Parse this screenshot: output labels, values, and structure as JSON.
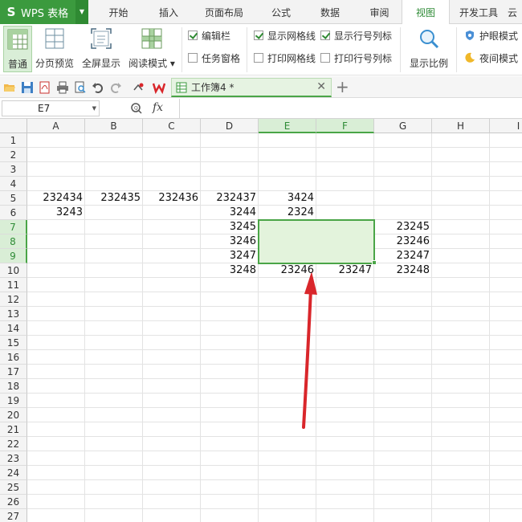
{
  "app": {
    "title": "WPS 表格"
  },
  "menu": {
    "tabs": [
      {
        "label": "开始"
      },
      {
        "label": "插入"
      },
      {
        "label": "页面布局"
      },
      {
        "label": "公式"
      },
      {
        "label": "数据"
      },
      {
        "label": "审阅"
      },
      {
        "label": "视图"
      },
      {
        "label": "开发工具"
      },
      {
        "label": "云"
      }
    ],
    "active": "视图"
  },
  "ribbon": {
    "normal": "普通",
    "page_break_preview": "分页预览",
    "full_screen": "全屏显示",
    "reading_mode": "阅读模式",
    "edit_bar": "编辑栏",
    "task_pane": "任务窗格",
    "show_gridlines": "显示网格线",
    "show_headings": "显示行号列标",
    "print_gridlines": "打印网格线",
    "print_headings": "打印行号列标",
    "zoom": "显示比例",
    "eye_care": "护眼模式",
    "night_mode": "夜间模式"
  },
  "document": {
    "tab_label": "工作簿4 *"
  },
  "formula_bar": {
    "name_box": "E7",
    "fx_label": "fx",
    "formula": ""
  },
  "sheet": {
    "columns": [
      "A",
      "B",
      "C",
      "D",
      "E",
      "F",
      "G",
      "H",
      "I"
    ],
    "rows": [
      "1",
      "2",
      "3",
      "4",
      "5",
      "6",
      "7",
      "8",
      "9",
      "10",
      "11",
      "12",
      "13",
      "14",
      "15",
      "16",
      "17",
      "18",
      "19",
      "20",
      "21",
      "22",
      "23",
      "24",
      "25",
      "26",
      "27"
    ],
    "cells": {
      "A5": "232434",
      "B5": "232435",
      "C5": "232436",
      "D5": "232437",
      "E5": "3424",
      "A6": "3243",
      "D6": "3244",
      "E6": "2324",
      "D7": "3245",
      "G7": "23245",
      "D8": "3246",
      "G8": "23246",
      "D9": "3247",
      "G9": "23247",
      "D10": "3248",
      "E10": "23246",
      "F10": "23247",
      "G10": "23248"
    },
    "selection": "E7:F9",
    "highlight_columns": [
      "E",
      "F"
    ],
    "highlight_rows": [
      "7",
      "8",
      "9"
    ]
  },
  "colors": {
    "accent": "#4aa547",
    "brand": "#3b9a3e",
    "arrow": "#d9262b"
  }
}
